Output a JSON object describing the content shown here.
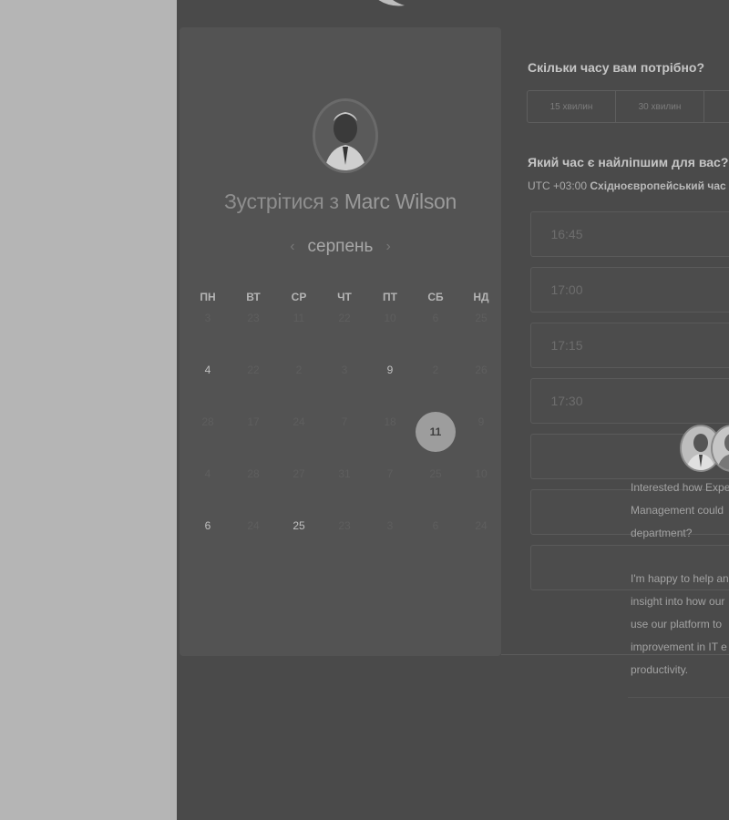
{
  "calendar": {
    "title_prefix": "Зустрітися з",
    "title_name": "Marc Wilson",
    "month": "серпень",
    "prev_arrow": "‹",
    "next_arrow": "›",
    "weekdays": [
      "ПН",
      "ВТ",
      "СР",
      "ЧТ",
      "ПТ",
      "СБ",
      "НД"
    ],
    "weeks": [
      [
        "3",
        "23",
        "11",
        "22",
        "10",
        "6",
        "25"
      ],
      [
        "4",
        "22",
        "2",
        "3",
        "9",
        "2",
        "26"
      ],
      [
        "28",
        "17",
        "24",
        "7",
        "18",
        "11",
        "9"
      ],
      [
        "4",
        "28",
        "27",
        "31",
        "7",
        "25",
        "10"
      ],
      [
        "6",
        "24",
        "25",
        "23",
        "3",
        "6",
        "24"
      ]
    ],
    "active_days": [
      "4",
      "9",
      "11",
      "6",
      "25"
    ],
    "selected_day": "11"
  },
  "duration": {
    "title": "Скільки часу вам потрібно?",
    "options": [
      "15 хвилин",
      "30 хвилин"
    ]
  },
  "time_section": {
    "title": "Який час є найліпшим для вас?",
    "tz_offset": "UTC +03:00",
    "tz_name": "Східноєвропейський час"
  },
  "slots": [
    "16:45",
    "17:00",
    "17:15",
    "17:30",
    "",
    "",
    ""
  ],
  "chat": {
    "lines": [
      "Interested how Expert",
      "Management could",
      "department?",
      "I'm happy to help and",
      "insight into how our",
      "use our platform to",
      "improvement in IT e",
      "productivity."
    ]
  },
  "colors": {
    "page_bg": "#b5b5b5",
    "panel_bg": "#4a4a4a",
    "selected_day_bg": "#9d9d9d"
  }
}
